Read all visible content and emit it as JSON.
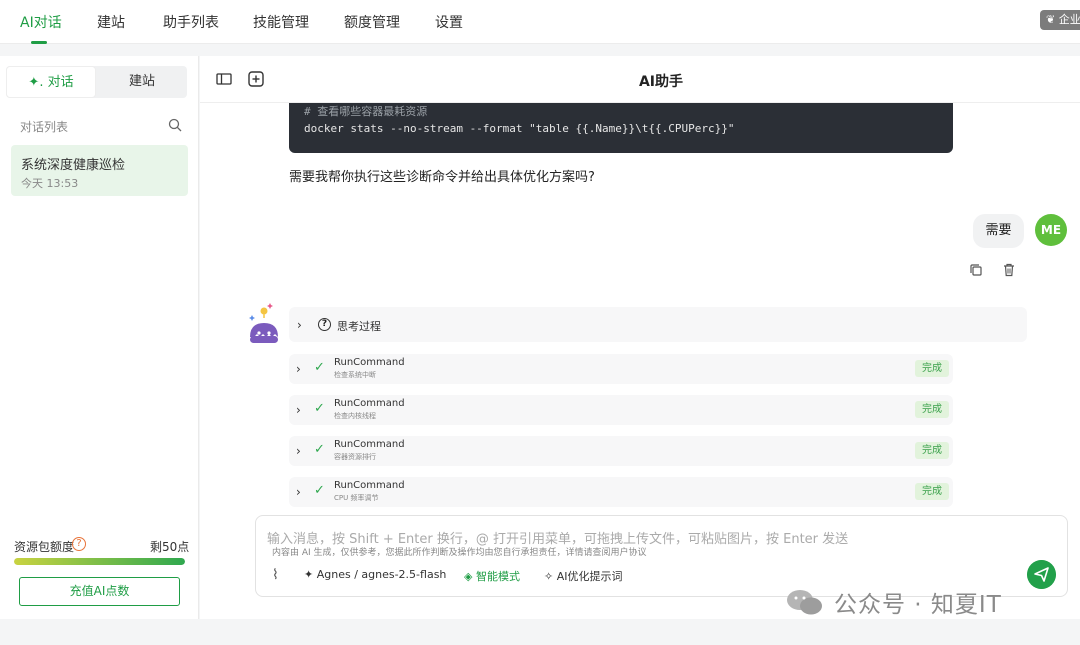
{
  "topnav": {
    "tabs": [
      {
        "label": "AI对话",
        "active": true
      },
      {
        "label": "建站"
      },
      {
        "label": "助手列表"
      },
      {
        "label": "技能管理"
      },
      {
        "label": "额度管理"
      },
      {
        "label": "设置"
      }
    ],
    "corner_label": "企业"
  },
  "sidebar": {
    "seg_chat": "对话",
    "seg_site": "建站",
    "list_title": "对话列表",
    "conversation": {
      "title": "系统深度健康巡检",
      "time": "今天 13:53"
    },
    "quota_label": "资源包额度",
    "quota_value": "剩50点",
    "quota_fill_fraction": 1.0,
    "recharge_label": "充值AI点数"
  },
  "chat": {
    "title": "AI助手",
    "code_lines": [
      "# 查看哪些容器最耗资源",
      "docker stats --no-stream --format \"table {{.Name}}\\t{{.CPUPerc}}\""
    ],
    "assistant_question": "需要我帮你执行这些诊断命令并给出具体优化方案吗?",
    "user_message": "需要",
    "user_avatar": "ME",
    "thinking_label": "思考过程",
    "tools": [
      {
        "name": "RunCommand",
        "desc": "检查系统中断",
        "status": "完成"
      },
      {
        "name": "RunCommand",
        "desc": "检查内核线程",
        "status": "完成"
      },
      {
        "name": "RunCommand",
        "desc": "容器资源排行",
        "status": "完成"
      },
      {
        "name": "RunCommand",
        "desc": "CPU 频率调节",
        "status": "完成"
      }
    ]
  },
  "input": {
    "placeholder": "输入消息，按 Shift + Enter 换行，@ 打开引用菜单，可拖拽上传文件，可粘贴图片，按 Enter 发送",
    "model": "Agnes / agnes-2.5-flash",
    "smart_mode": "智能模式",
    "optimize": "AI优化提示词",
    "disclaimer": "内容由 AI 生成，仅供参考，您据此所作判断及操作均由您自行承担责任，详情请查阅用户协议"
  },
  "watermark": "公众号 · 知夏IT",
  "colors": {
    "accent": "#1f9d45",
    "code_bg": "#2b2f36",
    "avatar": "#5fbf3c",
    "badge_bg": "#e2f3dc"
  }
}
